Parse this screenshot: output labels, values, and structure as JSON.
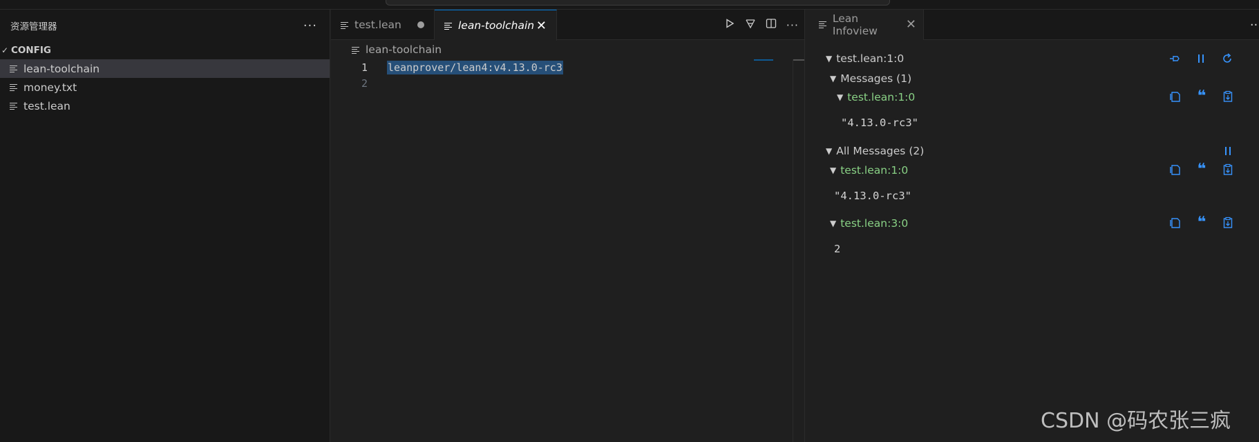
{
  "sidebar": {
    "title": "资源管理器",
    "more_icon": "···",
    "section": "CONFIG",
    "files": [
      "lean-toolchain",
      "money.txt",
      "test.lean"
    ],
    "active_file_index": 0
  },
  "editor": {
    "tabs": [
      {
        "label": "test.lean",
        "modified": true
      },
      {
        "label": "lean-toolchain",
        "active": true
      }
    ],
    "breadcrumb": "lean-toolchain",
    "lines": [
      {
        "number": "1",
        "text": "leanprover/lean4:v4.13.0-rc3"
      },
      {
        "number": "2",
        "text": ""
      }
    ],
    "actions": [
      "run-icon",
      "compare-icon",
      "split-editor-icon",
      "more-icon"
    ]
  },
  "infoview": {
    "tab_label": "Lean Infoview",
    "goal_header": "test.lean:1:0",
    "messages_header": "Messages (1)",
    "message_loc": "test.lean:1:0",
    "message_value": "\"4.13.0-rc3\"",
    "all_messages_header": "All Messages (2)",
    "all_messages": [
      {
        "loc": "test.lean:1:0",
        "value": "\"4.13.0-rc3\""
      },
      {
        "loc": "test.lean:3:0",
        "value": "2"
      }
    ]
  },
  "watermark": "CSDN @码农张三疯",
  "colors": {
    "accent": "#0078d4",
    "green_loc": "#89d185",
    "action_blue": "#3794ff",
    "selection": "#264f78"
  }
}
